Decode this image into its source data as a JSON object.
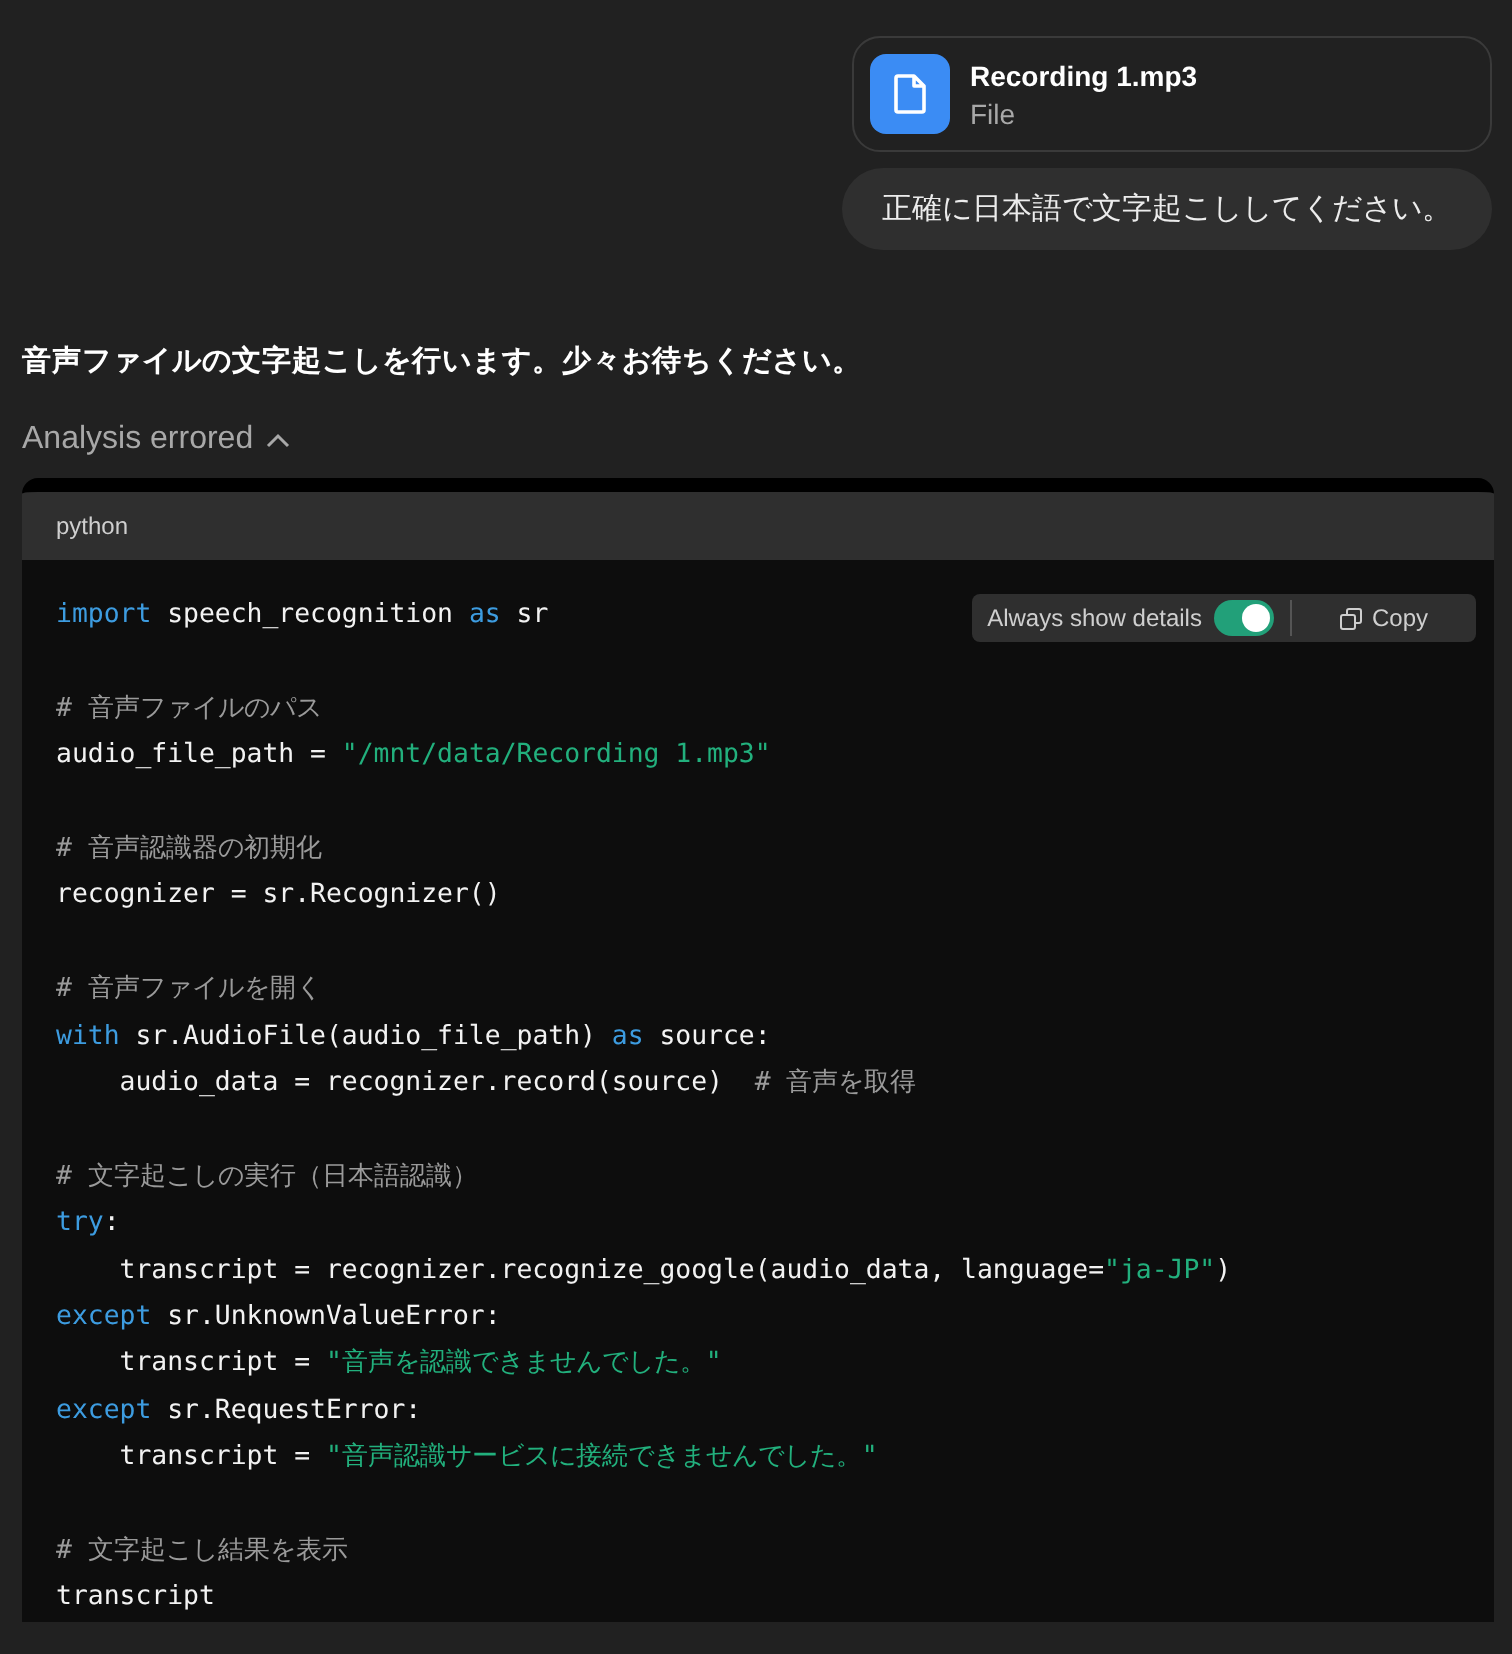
{
  "attachment": {
    "name": "Recording 1.mp3",
    "type": "File"
  },
  "user_message": "正確に日本語で文字起こししてください。",
  "assistant_message": "音声ファイルの文字起こしを行います。少々お待ちください。",
  "analysis": {
    "label": "Analysis errored",
    "expanded": true
  },
  "code_block": {
    "language": "python",
    "always_show_details": {
      "label": "Always show details",
      "on": true
    },
    "copy_label": "Copy",
    "blocks": [
      [
        [
          {
            "kind": "keyword",
            "text": "import"
          },
          {
            "kind": "plain",
            "text": " speech_recognition "
          },
          {
            "kind": "keyword",
            "text": "as"
          },
          {
            "kind": "plain",
            "text": " sr"
          }
        ]
      ],
      [
        [
          {
            "kind": "comment",
            "text": "# 音声ファイルのパス"
          }
        ],
        [
          {
            "kind": "plain",
            "text": "audio_file_path = "
          },
          {
            "kind": "string",
            "text": "\"/mnt/data/Recording 1.mp3\""
          }
        ]
      ],
      [
        [
          {
            "kind": "comment",
            "text": "# 音声認識器の初期化"
          }
        ],
        [
          {
            "kind": "plain",
            "text": "recognizer = sr.Recognizer()"
          }
        ]
      ],
      [
        [
          {
            "kind": "comment",
            "text": "# 音声ファイルを開く"
          }
        ],
        [
          {
            "kind": "keyword",
            "text": "with"
          },
          {
            "kind": "plain",
            "text": " sr.AudioFile(audio_file_path) "
          },
          {
            "kind": "keyword",
            "text": "as"
          },
          {
            "kind": "plain",
            "text": " source:"
          }
        ],
        [
          {
            "kind": "plain",
            "text": "    audio_data = recognizer.record(source)  "
          },
          {
            "kind": "comment",
            "text": "# 音声を取得"
          }
        ]
      ],
      [
        [
          {
            "kind": "comment",
            "text": "# 文字起こしの実行（日本語認識）"
          }
        ],
        [
          {
            "kind": "keyword",
            "text": "try"
          },
          {
            "kind": "plain",
            "text": ":"
          }
        ],
        [
          {
            "kind": "plain",
            "text": "    transcript = recognizer.recognize_google(audio_data, language="
          },
          {
            "kind": "string",
            "text": "\"ja-JP\""
          },
          {
            "kind": "plain",
            "text": ")"
          }
        ],
        [
          {
            "kind": "keyword",
            "text": "except"
          },
          {
            "kind": "plain",
            "text": " sr.UnknownValueError:"
          }
        ],
        [
          {
            "kind": "plain",
            "text": "    transcript = "
          },
          {
            "kind": "string",
            "text": "\"音声を認識できませんでした。\""
          }
        ],
        [
          {
            "kind": "keyword",
            "text": "except"
          },
          {
            "kind": "plain",
            "text": " sr.RequestError:"
          }
        ],
        [
          {
            "kind": "plain",
            "text": "    transcript = "
          },
          {
            "kind": "string",
            "text": "\"音声認識サービスに接続できませんでした。\""
          }
        ]
      ],
      [
        [
          {
            "kind": "comment",
            "text": "# 文字起こし結果を表示"
          }
        ],
        [
          {
            "kind": "plain",
            "text": "transcript"
          }
        ]
      ]
    ]
  }
}
